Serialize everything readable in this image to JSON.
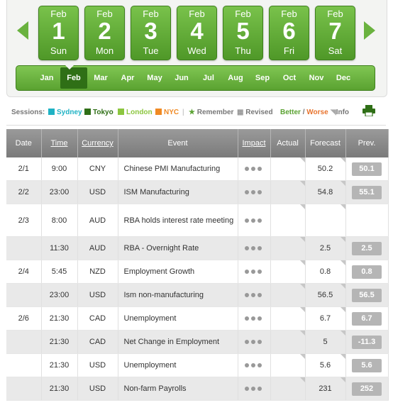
{
  "calendar": {
    "days": [
      {
        "month": "Feb",
        "day": "1",
        "weekday": "Sun"
      },
      {
        "month": "Feb",
        "day": "2",
        "weekday": "Mon"
      },
      {
        "month": "Feb",
        "day": "3",
        "weekday": "Tue"
      },
      {
        "month": "Feb",
        "day": "4",
        "weekday": "Wed"
      },
      {
        "month": "Feb",
        "day": "5",
        "weekday": "Thu"
      },
      {
        "month": "Feb",
        "day": "6",
        "weekday": "Fri"
      },
      {
        "month": "Feb",
        "day": "7",
        "weekday": "Sat"
      }
    ],
    "months": [
      "Jan",
      "Feb",
      "Mar",
      "Apr",
      "May",
      "Jun",
      "Jul",
      "Aug",
      "Sep",
      "Oct",
      "Nov",
      "Dec"
    ],
    "selected_month": "Feb"
  },
  "legend": {
    "sessions_label": "Sessions:",
    "sydney": "Sydney",
    "tokyo": "Tokyo",
    "london": "London",
    "nyc": "NYC",
    "remember": "Remember",
    "revised": "Revised",
    "better": "Better",
    "slash": "/",
    "worse": "Worse",
    "info": "Info",
    "colors": {
      "sydney": "#1fb2c4",
      "tokyo": "#2f6f16",
      "london": "#8cc63f",
      "nyc": "#f08a24",
      "better": "#5aa231",
      "worse": "#e8742e"
    }
  },
  "table": {
    "headers": [
      "Date",
      "Time",
      "Currency",
      "Event",
      "Impact",
      "Actual",
      "Forecast",
      "Prev."
    ],
    "rows": [
      {
        "date": "2/1",
        "time": "9:00",
        "currency": "CNY",
        "event": "Chinese PMI Manufacturing",
        "actual": "",
        "forecast": "50.2",
        "prev": "50.1"
      },
      {
        "date": "2/2",
        "time": "23:00",
        "currency": "USD",
        "event": "ISM Manufacturing",
        "actual": "",
        "forecast": "54.8",
        "prev": "55.1"
      },
      {
        "date": "2/3",
        "time": "8:00",
        "currency": "AUD",
        "event": "RBA holds interest rate meeting",
        "actual": "",
        "forecast": "",
        "prev": ""
      },
      {
        "date": "",
        "time": "11:30",
        "currency": "AUD",
        "event": "RBA - Overnight Rate",
        "actual": "",
        "forecast": "2.5",
        "prev": "2.5"
      },
      {
        "date": "2/4",
        "time": "5:45",
        "currency": "NZD",
        "event": "Employment Growth",
        "actual": "",
        "forecast": "0.8",
        "prev": "0.8"
      },
      {
        "date": "",
        "time": "23:00",
        "currency": "USD",
        "event": "Ism non-manufacturing",
        "actual": "",
        "forecast": "56.5",
        "prev": "56.5"
      },
      {
        "date": "2/6",
        "time": "21:30",
        "currency": "CAD",
        "event": "Unemployment",
        "actual": "",
        "forecast": "6.7",
        "prev": "6.7"
      },
      {
        "date": "",
        "time": "21:30",
        "currency": "CAD",
        "event": "Net Change in Employment",
        "actual": "",
        "forecast": "5",
        "prev": "-11.3"
      },
      {
        "date": "",
        "time": "21:30",
        "currency": "USD",
        "event": "Unemployment",
        "actual": "",
        "forecast": "5.6",
        "prev": "5.6"
      },
      {
        "date": "",
        "time": "21:30",
        "currency": "USD",
        "event": "Non-farm Payrolls",
        "actual": "",
        "forecast": "231",
        "prev": "252"
      }
    ]
  }
}
